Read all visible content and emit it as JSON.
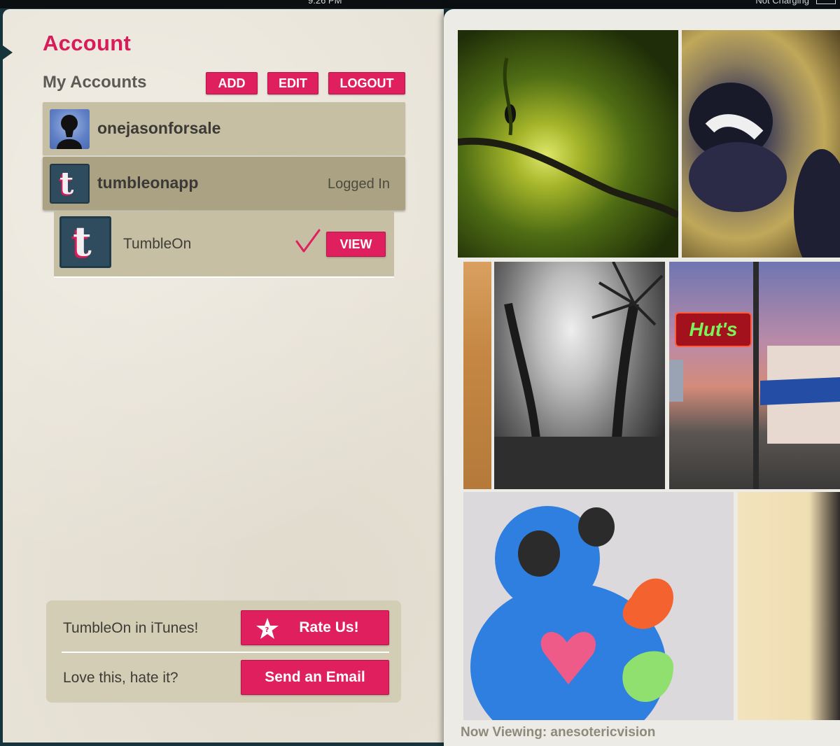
{
  "status_bar": {
    "time": "9:26 PM",
    "charge": "Not Charging"
  },
  "account": {
    "title": "Account",
    "section_label": "My Accounts",
    "buttons": {
      "add": "ADD",
      "edit": "EDIT",
      "logout": "LOGOUT"
    },
    "accounts": [
      {
        "name": "onejasonforsale",
        "status": ""
      },
      {
        "name": "tumbleonapp",
        "status": "Logged In"
      }
    ],
    "blog": {
      "name": "TumbleOn",
      "view_label": "VIEW"
    }
  },
  "bottom": {
    "itunes_label": "TumbleOn in iTunes!",
    "rate_label": "Rate Us!",
    "feedback_label": "Love this, hate it?",
    "email_label": "Send an Email"
  },
  "viewer": {
    "now_viewing": "Now Viewing: anesotericvision",
    "sign_text": "Hut's"
  },
  "colors": {
    "accent": "#e01f5f",
    "title": "#d81c5a"
  }
}
